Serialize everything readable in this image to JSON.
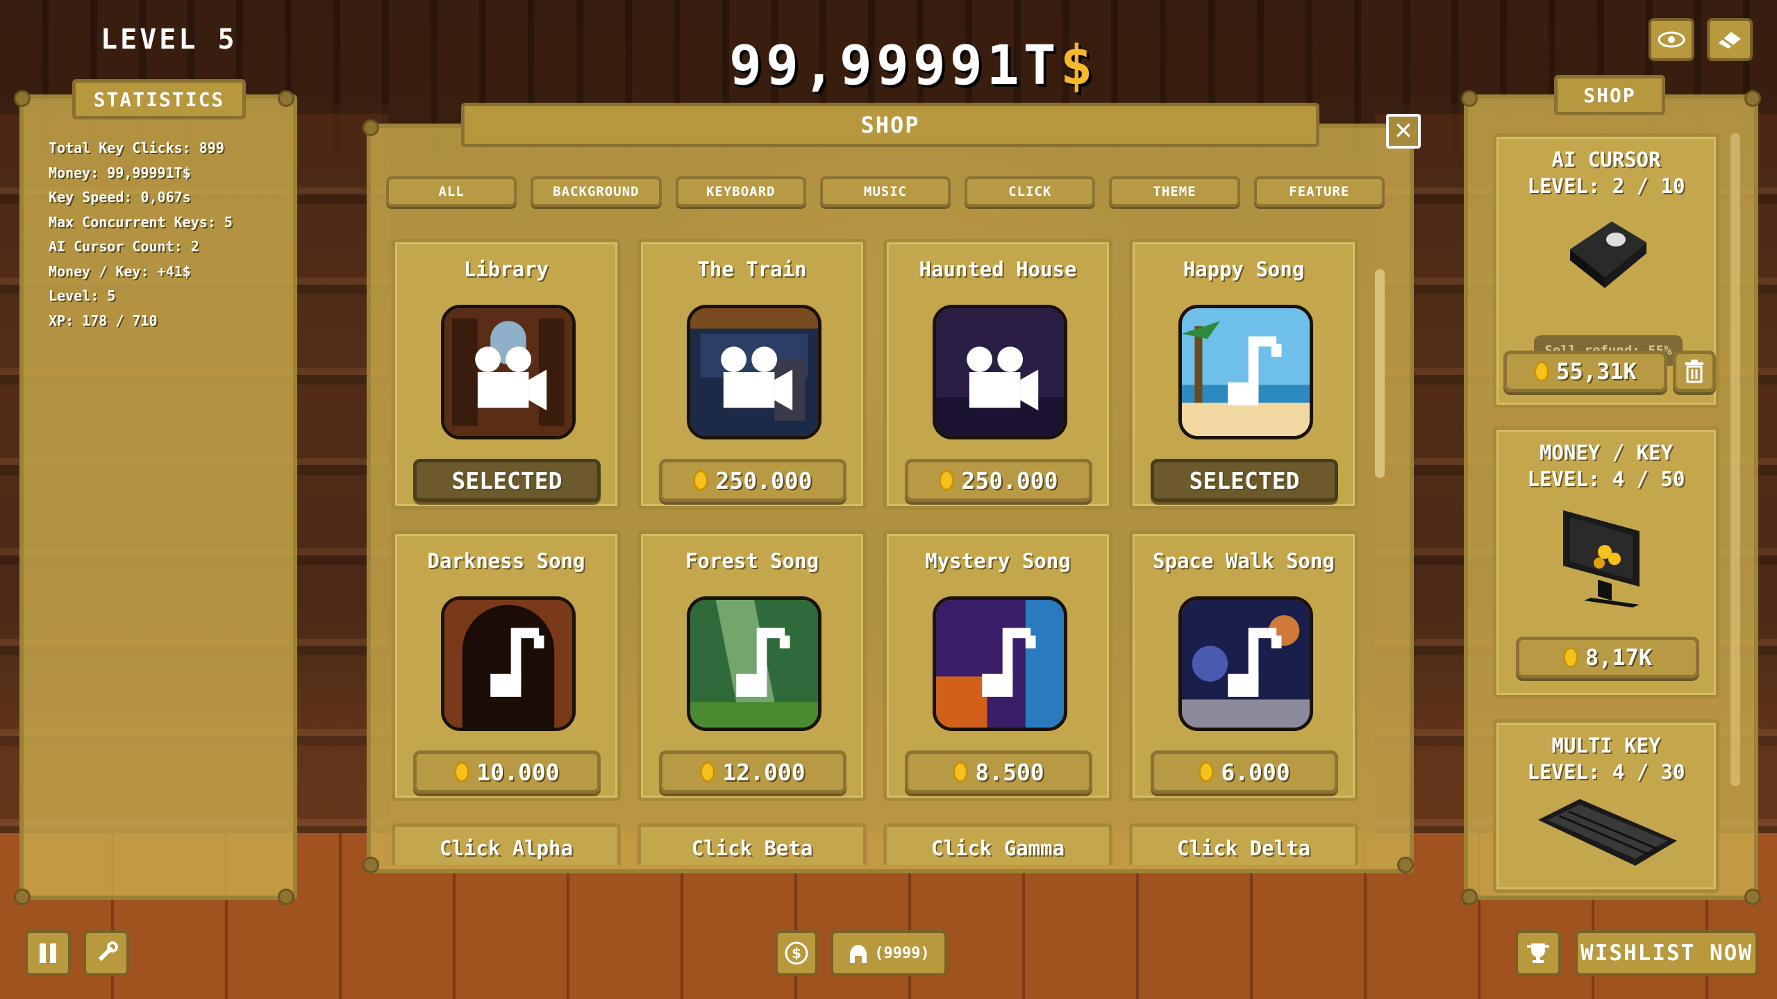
{
  "hud": {
    "level": "LEVEL 5",
    "money_value": "99,99991T",
    "money_symbol": "$"
  },
  "top_right": {
    "eye_icon": "eye-icon",
    "eraser_icon": "eraser-icon"
  },
  "statistics": {
    "title": "STATISTICS",
    "lines": [
      "Total Key Clicks: 899",
      "Money: 99,99991T$",
      "Key Speed: 0,067s",
      "Max Concurrent Keys: 5",
      "AI Cursor Count: 2",
      "Money / Key: +41$",
      "Level: 5",
      "XP: 178 / 710"
    ]
  },
  "shop": {
    "title": "SHOP",
    "close_icon": "close-icon",
    "tabs": [
      "ALL",
      "BACKGROUND",
      "KEYBOARD",
      "MUSIC",
      "CLICK",
      "THEME",
      "FEATURE"
    ],
    "items": [
      {
        "name": "Library",
        "button": "SELECTED",
        "selected": true,
        "icon": "video-camera-icon"
      },
      {
        "name": "The Train",
        "button": "250.000",
        "selected": false,
        "icon": "video-camera-icon"
      },
      {
        "name": "Haunted House",
        "button": "250.000",
        "selected": false,
        "icon": "video-camera-icon"
      },
      {
        "name": "Happy Song",
        "button": "SELECTED",
        "selected": true,
        "icon": "music-note-icon"
      },
      {
        "name": "Darkness Song",
        "button": "10.000",
        "selected": false,
        "icon": "music-note-icon"
      },
      {
        "name": "Forest Song",
        "button": "12.000",
        "selected": false,
        "icon": "music-note-icon"
      },
      {
        "name": "Mystery Song",
        "button": "8.500",
        "selected": false,
        "icon": "music-note-icon"
      },
      {
        "name": "Space Walk Song",
        "button": "6.000",
        "selected": false,
        "icon": "music-note-icon"
      },
      {
        "name": "Click Alpha"
      },
      {
        "name": "Click Beta"
      },
      {
        "name": "Click Gamma"
      },
      {
        "name": "Click Delta"
      }
    ]
  },
  "upgrades": {
    "title": "SHOP",
    "ai_cursor": {
      "title1": "AI CURSOR",
      "title2": "LEVEL: 2 / 10",
      "sell": "Sell refund: 55%",
      "price": "55,31K",
      "trash_icon": "trash-icon"
    },
    "money_key": {
      "title1": "MONEY / KEY",
      "title2": "LEVEL: 4 / 50",
      "price": "8,17K"
    },
    "multi_key": {
      "title1": "MULTI KEY",
      "title2": "LEVEL: 4 / 30"
    }
  },
  "bottom": {
    "pause_icon": "pause-icon",
    "wrench_icon": "wrench-icon",
    "steam_icon": "steam-icon",
    "helmet_count": "(9999)",
    "trophy_icon": "trophy-icon",
    "wishlist": "WISHLIST NOW"
  },
  "colors": {
    "accent_gold": "#c4a64c",
    "coin": "#f5c21d",
    "dollar": "#f3b82c"
  }
}
